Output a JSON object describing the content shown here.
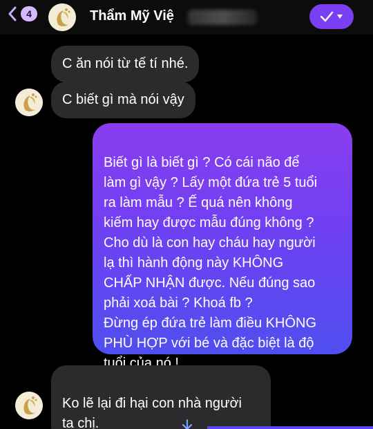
{
  "header": {
    "back_badge": "4",
    "title": "Thẩm Mỹ Việ",
    "avatar_icon": "salon-logo-icon",
    "action_icon": "checkmark-dropdown-icon"
  },
  "messages": [
    {
      "direction": "incoming",
      "text": "C ăn nói từ tế tí nhé.",
      "show_avatar": false
    },
    {
      "direction": "incoming",
      "text": "C biết gì mà nói vậy",
      "show_avatar": true
    },
    {
      "direction": "outgoing",
      "text": "Biết gì là biết gì ? Có cái não để\nlàm gì vậy ? Lấy một đứa trẻ 5 tuổi\nra làm mẫu ? Ế quá nên không\nkiếm hay được mẫu đúng không ?\nCho dù là con hay cháu hay người\nlạ thì hành động này KHÔNG\nCHẤP NHẬN được. Nếu đúng sao\nphải xoá bài ? Khoá fb ?\nĐừng ép đứa trẻ làm điều KHÔNG\nPHÙ HỢP với bé và đặc biệt là độ\ntuổi của nó !"
    },
    {
      "direction": "incoming",
      "text": "Ko lẽ lại đi hại con nhà người\nta chị.",
      "show_avatar": true
    }
  ],
  "colors": {
    "outgoing_top": "#8a3df0",
    "outgoing_bottom": "#4f4ff0",
    "incoming": "#2b2b2d",
    "accent": "#7b3ff2"
  },
  "scroll_icon": "arrow-down-icon"
}
